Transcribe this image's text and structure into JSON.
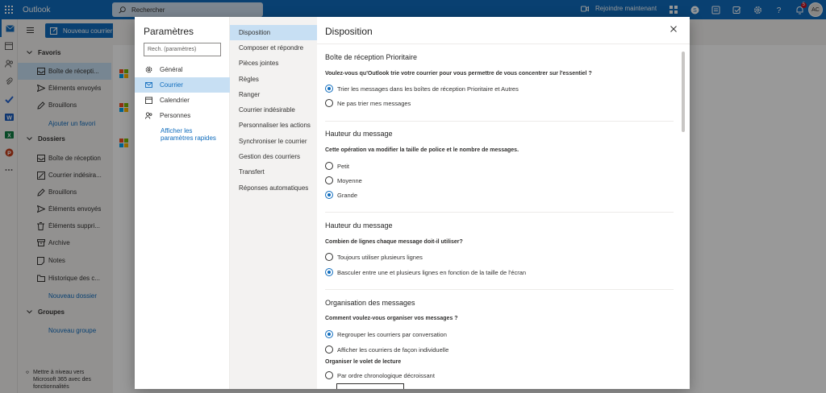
{
  "topbar": {
    "app_name": "Outlook",
    "search_placeholder": "Rechercher",
    "meet_label": "Rejoindre maintenant",
    "notification_count": "5",
    "avatar_initials": "AC",
    "accent": "#0f6cbd"
  },
  "folders": {
    "new_mail": "Nouveau courrier",
    "favorites_header": "Favoris",
    "favorites": [
      {
        "label": "Boîte de récepti...",
        "icon": "inbox-icon"
      },
      {
        "label": "Éléments envoyés",
        "icon": "send-icon"
      },
      {
        "label": "Brouillons",
        "icon": "pencil-icon"
      }
    ],
    "add_favorite": "Ajouter un favori",
    "folders_header": "Dossiers",
    "folder_items": [
      {
        "label": "Boîte de réception",
        "icon": "inbox-icon"
      },
      {
        "label": "Courrier indésira...",
        "icon": "junk-icon"
      },
      {
        "label": "Brouillons",
        "icon": "pencil-icon"
      },
      {
        "label": "Éléments envoyés",
        "icon": "send-icon"
      },
      {
        "label": "Éléments suppri...",
        "icon": "trash-icon"
      },
      {
        "label": "Archive",
        "icon": "archive-icon"
      },
      {
        "label": "Notes",
        "icon": "note-icon"
      },
      {
        "label": "Historique des c...",
        "icon": "folder-icon"
      }
    ],
    "new_folder": "Nouveau dossier",
    "groups_header": "Groupes",
    "new_group": "Nouveau groupe",
    "promo": "Mettre à niveau vers Microsoft 365 avec des fonctionnalités"
  },
  "settings": {
    "title": "Paramètres",
    "search_placeholder": "Rech. (paramètres)",
    "categories": [
      {
        "label": "Général",
        "icon": "gear-icon"
      },
      {
        "label": "Courrier",
        "icon": "mail-icon"
      },
      {
        "label": "Calendrier",
        "icon": "calendar-icon"
      },
      {
        "label": "Personnes",
        "icon": "people-icon"
      }
    ],
    "quick_settings_link": "Afficher les paramètres rapides",
    "subcategories": [
      "Disposition",
      "Composer et répondre",
      "Pièces jointes",
      "Règles",
      "Ranger",
      "Courrier indésirable",
      "Personnaliser les actions",
      "Synchroniser le courrier",
      "Gestion des courriers",
      "Transfert",
      "Réponses automatiques"
    ],
    "page_title": "Disposition",
    "focused": {
      "title": "Boîte de réception Prioritaire",
      "question": "Voulez-vous qu'Outlook trie votre courrier pour vous permettre de vous concentrer sur l'essentiel ?",
      "options": [
        "Trier les messages dans les boîtes de réception Prioritaire et Autres",
        "Ne pas trier mes messages"
      ],
      "selected": 0
    },
    "height": {
      "title": "Hauteur du message",
      "question": "Cette opération va modifier la taille de police et le nombre de messages.",
      "options": [
        "Petit",
        "Moyenne",
        "Grande"
      ],
      "selected": 2
    },
    "lines": {
      "title": "Hauteur du message",
      "question": "Combien de lignes chaque message doit-il utiliser?",
      "options": [
        "Toujours utiliser plusieurs lignes",
        "Basculer entre une et plusieurs lignes en fonction de la taille de l'écran"
      ],
      "selected": 1
    },
    "organization": {
      "title": "Organisation des messages",
      "question": "Comment voulez-vous organiser vos messages ?",
      "options": [
        "Regrouper les courriers par conversation",
        "Afficher les courriers de façon individuelle"
      ],
      "selected": 0,
      "reading_header": "Organiser le volet de lecture",
      "reading_options": [
        "Par ordre chronologique décroissant"
      ]
    }
  }
}
